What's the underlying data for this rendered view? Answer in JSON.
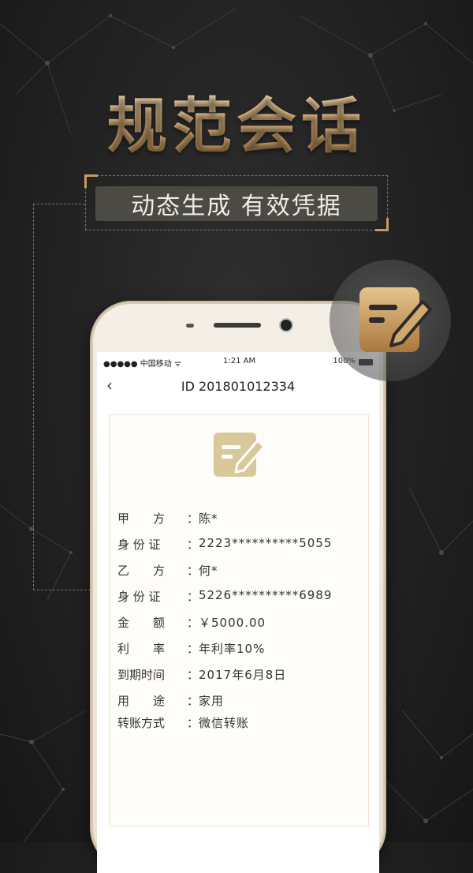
{
  "promo": {
    "headline": "规范会话",
    "subheadline": "动态生成 有效凭据"
  },
  "status_bar": {
    "carrier": "●●●●● 中国移动 ᯤ",
    "time": "1:21 AM",
    "battery": "100%"
  },
  "nav": {
    "back_icon": "‹",
    "title": "ID 201801012334"
  },
  "contract": {
    "fields": [
      {
        "label": "甲　　方",
        "value": "陈*"
      },
      {
        "label": "身 份 证",
        "value": "2223**********5055"
      },
      {
        "label": "乙　　方",
        "value": "何*"
      },
      {
        "label": "身 份 证",
        "value": "5226**********6989"
      },
      {
        "label": "金　　额",
        "value": "￥5000.00"
      },
      {
        "label": "利　　率",
        "value": "年利率10%"
      },
      {
        "label": "到期时间",
        "value": "2017年6月8日"
      },
      {
        "label": "用　　途",
        "value": "家用"
      },
      {
        "label": "转账方式",
        "value": "微信转账"
      }
    ]
  },
  "icons": {
    "doc_edit": "note-edit-icon",
    "back": "chevron-left-icon",
    "battery": "battery-icon"
  },
  "colors": {
    "gold": "#c9a466",
    "gold_light": "#d9c89a",
    "background": "#1e1e1e"
  }
}
